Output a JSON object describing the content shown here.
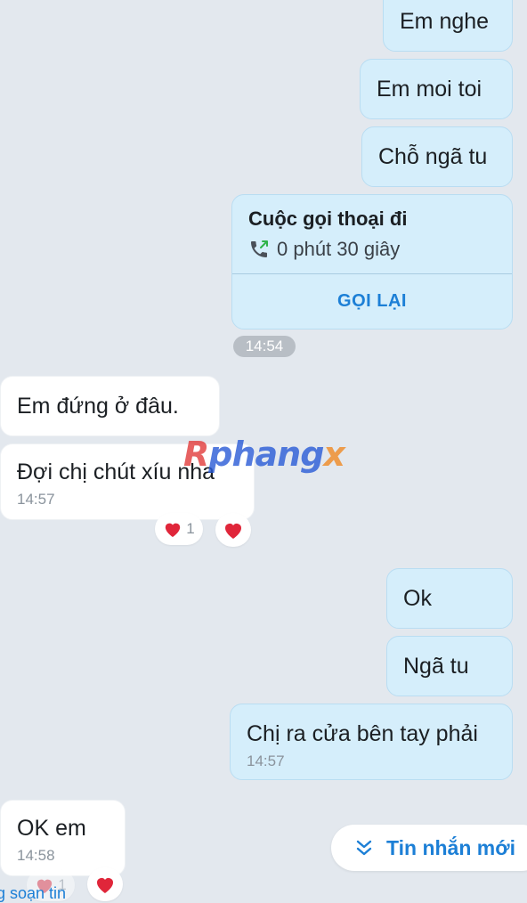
{
  "messages": {
    "out_em_nghe": "Em nghe",
    "out_em_moi_toi": "Em moi toi",
    "out_cho_nga_tu": "Chỗ ngã tu",
    "out_ok": "Ok",
    "out_nga_tu": "Ngã tu",
    "out_chi_ra": "Chị ra cửa bên tay phải",
    "out_chi_ra_time": "14:57",
    "in_em_dung": "Em đứng ở đâu.",
    "in_doi_chi": "Đợi chị chút xíu nha",
    "in_doi_chi_time": "14:57",
    "in_ok_em": "OK em",
    "in_ok_em_time": "14:58"
  },
  "call_card": {
    "title": "Cuộc gọi thoại đi",
    "duration": "0 phút 30 giây",
    "action_label": "GỌI LẠI",
    "icon": "outgoing-call-icon"
  },
  "time_separator": "14:54",
  "reactions": {
    "doi_chi_count": "1",
    "ok_em_count": "1",
    "icon": "heart-icon"
  },
  "watermark": {
    "part1": "R",
    "part2": "phang",
    "part3": "x"
  },
  "new_message_button": {
    "label": "Tin nhắn mới",
    "icon": "double-chevron-down-icon"
  },
  "typing_indicator": "g soạn tin",
  "colors": {
    "background": "#e3e8ee",
    "outgoing_bubble": "#d5eefb",
    "incoming_bubble": "#ffffff",
    "accent": "#1c7fd6",
    "heart": "#e0263a"
  }
}
